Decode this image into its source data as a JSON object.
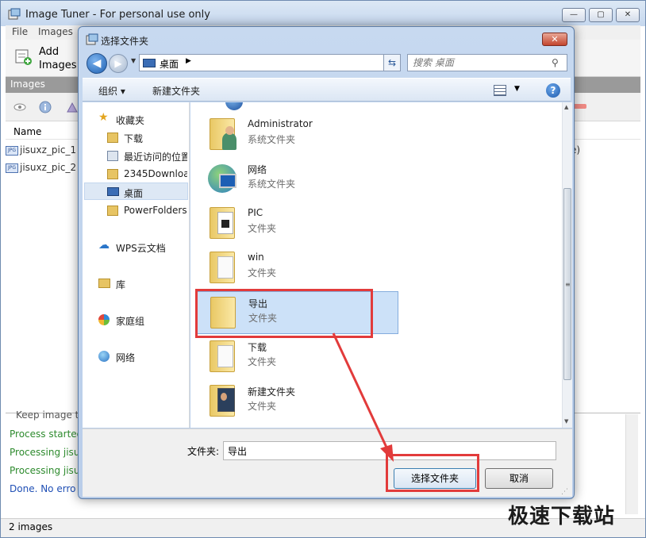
{
  "main_window": {
    "title": "Image Tuner - For personal use only",
    "menu": [
      "File",
      "Images"
    ],
    "toolbar": {
      "add_label_line1": "Add",
      "add_label_line2": "Images"
    },
    "panel_header": "Images",
    "column_name": "Name",
    "files": [
      "jisuxz_pic_1",
      "jisuxz_pic_2"
    ],
    "row_tail": "e)",
    "log": [
      {
        "text": "Keep image t",
        "color": "#555555"
      },
      {
        "text": "Process started",
        "color": "#2e8b2e"
      },
      {
        "text": "Processing jisu",
        "color": "#2e8b2e"
      },
      {
        "text": "Processing jisu",
        "color": "#2e8b2e"
      },
      {
        "text": "Done. No erro",
        "color": "#1f4fb5"
      }
    ],
    "status": "2 images",
    "window_controls": {
      "minimize": "—",
      "maximize": "▢",
      "close": "✕"
    }
  },
  "dialog": {
    "title": "选择文件夹",
    "address": "桌面",
    "search_placeholder": "搜索 桌面",
    "commands": {
      "organize": "组织 ▾",
      "new_folder": "新建文件夹"
    },
    "nav": {
      "favorites": "收藏夹",
      "downloads": "下载",
      "recent": "最近访问的位置",
      "folder_2345": "2345Downloads",
      "desktop": "桌面",
      "powerfolders": "PowerFolders",
      "wps": "WPS云文档",
      "library": "库",
      "homegroup": "家庭组",
      "network": "网络"
    },
    "items": [
      {
        "name": "Administrator",
        "type": "系统文件夹"
      },
      {
        "name": "网络",
        "type": "系统文件夹"
      },
      {
        "name": "PIC",
        "type": "文件夹"
      },
      {
        "name": "win",
        "type": "文件夹"
      },
      {
        "name": "导出",
        "type": "文件夹"
      },
      {
        "name": "下载",
        "type": "文件夹"
      },
      {
        "name": "新建文件夹",
        "type": "文件夹"
      }
    ],
    "folder_label": "文件夹:",
    "folder_value": "导出",
    "select_button": "选择文件夹",
    "cancel_button": "取消",
    "close": "✕"
  },
  "watermark": "极速下载站",
  "colors": {
    "annotation_red": "#e23b3b",
    "selection_blue": "#cce1f8"
  }
}
